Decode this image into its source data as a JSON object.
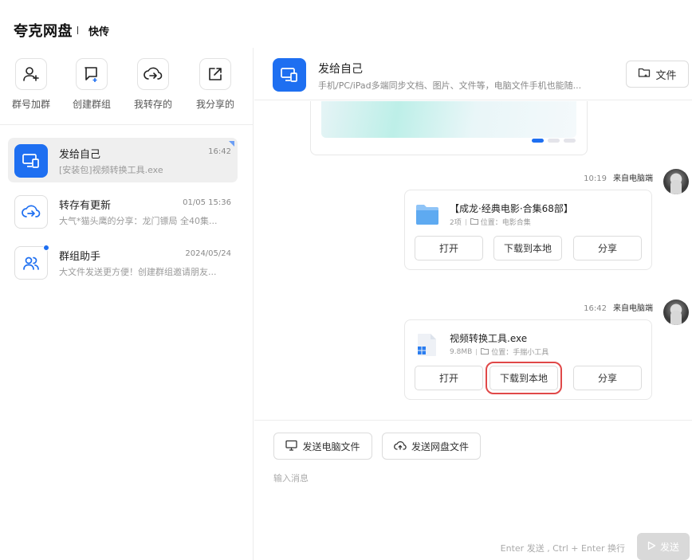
{
  "app": {
    "brand": "夸克网盘",
    "subtitle": "快传"
  },
  "quick_actions": [
    {
      "label": "群号加群",
      "icon": "add-user-icon"
    },
    {
      "label": "创建群组",
      "icon": "create-group-icon"
    },
    {
      "label": "我转存的",
      "icon": "cloud-transfer-icon"
    },
    {
      "label": "我分享的",
      "icon": "share-out-icon"
    }
  ],
  "conversations": [
    {
      "name": "发给自己",
      "time": "16:42",
      "preview": "[安装包]视频转换工具.exe",
      "icon": "device-icon",
      "active": true
    },
    {
      "name": "转存有更新",
      "time": "01/05 15:36",
      "preview": "大气*猫头鹰的分享：龙门镖局 全40集...",
      "icon": "cloud-transfer-icon",
      "active": false
    },
    {
      "name": "群组助手",
      "time": "2024/05/24",
      "preview": "大文件发送更方便！创建群组邀请朋友...",
      "icon": "group-icon",
      "active": false
    }
  ],
  "chat": {
    "title": "发给自己",
    "subtitle": "手机/PC/iPad多端同步文档、图片、文件等，电脑文件手机也能随...",
    "file_button": "文件"
  },
  "messages": [
    {
      "time": "10:19",
      "source": "来自电脑端",
      "file_name": "【成龙·经典电影·合集68部】",
      "meta_size": "2项",
      "meta_location": "位置：电影合集",
      "file_icon": "folder-icon",
      "actions": [
        "打开",
        "下载到本地",
        "分享"
      ]
    },
    {
      "time": "16:42",
      "source": "来自电脑端",
      "file_name": "视频转换工具.exe",
      "meta_size": "9.8MB",
      "meta_location": "位置：手揣小工具",
      "file_icon": "exe-file-icon",
      "actions": [
        "打开",
        "下载到本地",
        "分享"
      ]
    }
  ],
  "composer": {
    "send_pc_file": "发送电脑文件",
    "send_cloud_file": "发送网盘文件",
    "placeholder": "输入消息",
    "hint": "Enter 发送 , Ctrl + Enter 换行",
    "send_label": "发送"
  },
  "colors": {
    "accent": "#1e6ff1",
    "highlight": "#e04848"
  }
}
